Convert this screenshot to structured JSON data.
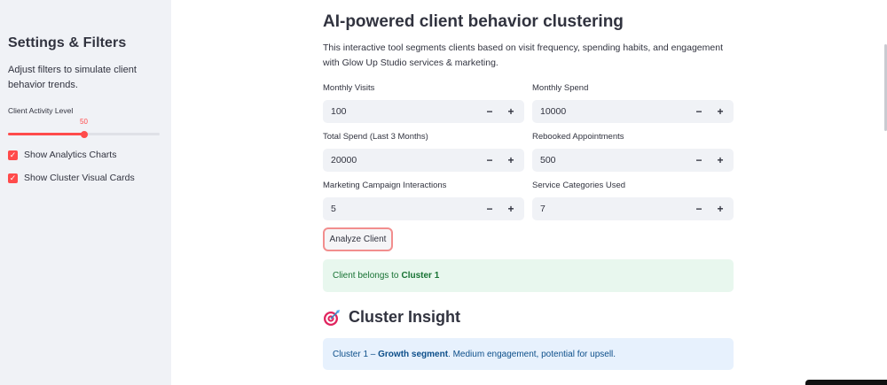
{
  "sidebar": {
    "title": "Settings & Filters",
    "description": "Adjust filters to simulate client behavior trends.",
    "slider": {
      "label": "Client Activity Level",
      "value": "50",
      "fraction": 0.5
    },
    "checkboxes": [
      {
        "label": "Show Analytics Charts",
        "checked": true
      },
      {
        "label": "Show Cluster Visual Cards",
        "checked": true
      }
    ]
  },
  "main": {
    "title": "AI-powered client behavior clustering",
    "intro": "This interactive tool segments clients based on visit frequency, spending habits, and engagement with Glow Up Studio services & marketing.",
    "fields": [
      {
        "label": "Monthly Visits",
        "value": "100"
      },
      {
        "label": "Monthly Spend",
        "value": "10000"
      },
      {
        "label": "Total Spend (Last 3 Months)",
        "value": "20000"
      },
      {
        "label": "Rebooked Appointments",
        "value": "500"
      },
      {
        "label": "Marketing Campaign Interactions",
        "value": "5"
      },
      {
        "label": "Service Categories Used",
        "value": "7"
      }
    ],
    "stepper": {
      "minus": "−",
      "plus": "+"
    },
    "analyze_button": "Analyze Client",
    "result": {
      "prefix": "Client belongs to",
      "cluster": "Cluster 1"
    },
    "insight": {
      "title": "Cluster Insight",
      "icon": "dart-target-icon",
      "cluster": "Cluster 1",
      "dash": " – ",
      "segment": "Growth segment",
      "detail": ". Medium engagement, potential for upsell."
    }
  },
  "colors": {
    "accent": "#ff4b4b",
    "sidebar_bg": "#f0f2f6",
    "success_bg": "#e8f7ee",
    "success_text": "#177233",
    "info_bg": "#e7f1fd",
    "info_text": "#0d4f8a"
  }
}
